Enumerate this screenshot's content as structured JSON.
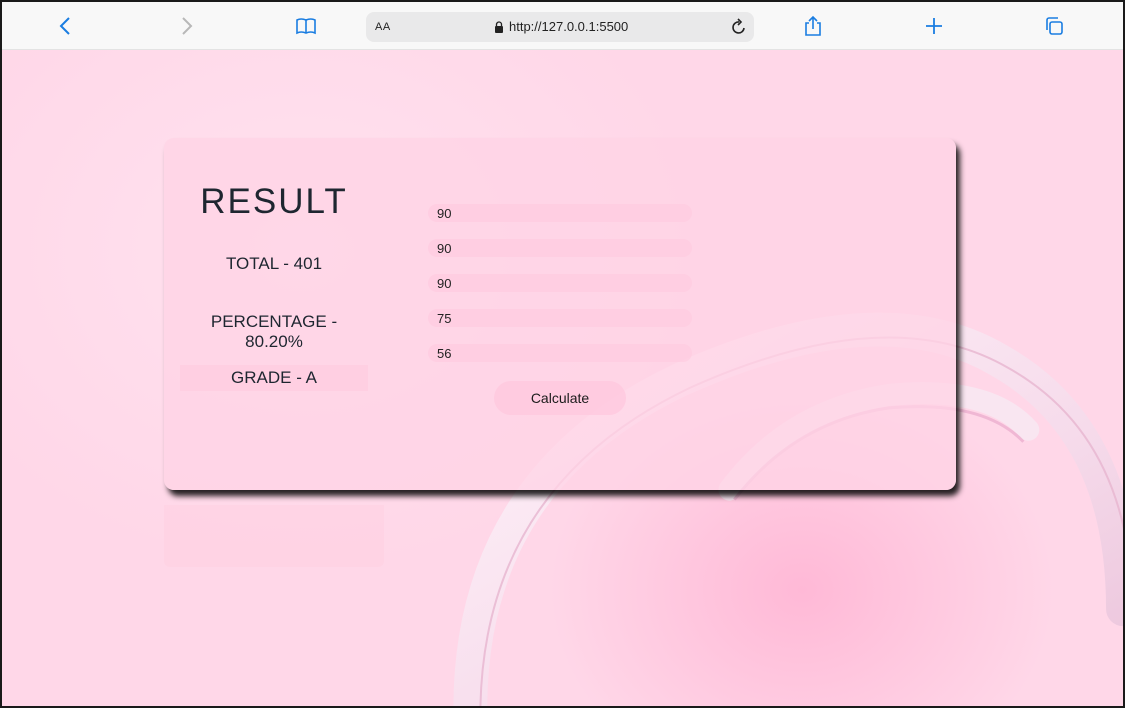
{
  "browser": {
    "aa_label": "AA",
    "url": "http://127.0.0.1:5500"
  },
  "result": {
    "title": "RESULT",
    "total": "TOTAL - 401",
    "percentage": "PERCENTAGE - 80.20%",
    "grade": "GRADE - A"
  },
  "marks": [
    "90",
    "90",
    "90",
    "75",
    "56"
  ],
  "calculate_label": "Calculate"
}
